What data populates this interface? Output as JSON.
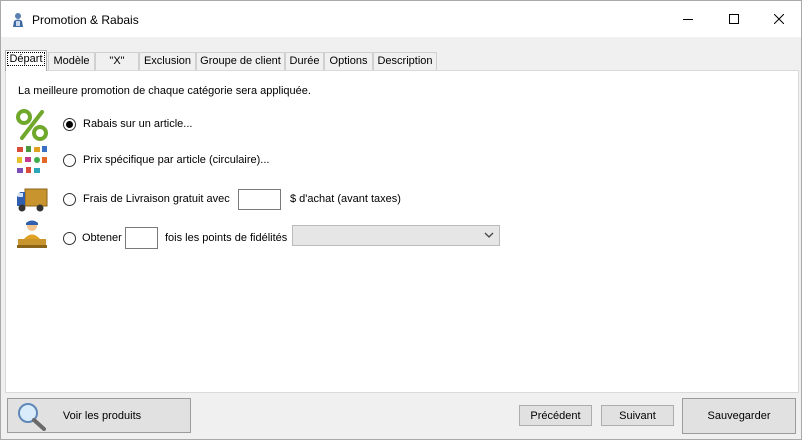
{
  "window": {
    "title": "Promotion & Rabais"
  },
  "tabs": [
    {
      "label": "Départ",
      "active": true
    },
    {
      "label": "Modèle"
    },
    {
      "label": "\"X\""
    },
    {
      "label": "Exclusion"
    },
    {
      "label": "Groupe de client"
    },
    {
      "label": "Durée"
    },
    {
      "label": "Options"
    },
    {
      "label": "Description"
    }
  ],
  "panel": {
    "intro": "La meilleure promotion de chaque catégorie sera appliquée.",
    "options": {
      "rabais": {
        "label": "Rabais sur un article...",
        "selected": true,
        "icon": "percent-icon"
      },
      "prix": {
        "label": "Prix spécifique par article (circulaire)...",
        "selected": false,
        "icon": "products-grid-icon"
      },
      "livraison": {
        "label": "Frais de Livraison gratuit avec",
        "suffix": "$ d'achat (avant taxes)",
        "value": "",
        "selected": false,
        "icon": "delivery-truck-icon"
      },
      "points": {
        "label": "Obtener",
        "suffix": "fois les points de fidélités",
        "value": "",
        "selected": false,
        "icon": "loyalty-person-icon"
      }
    },
    "points_combo": {
      "value": ""
    }
  },
  "buttons": {
    "voir_produits": "Voir les produits",
    "precedent": "Précédent",
    "suivant": "Suivant",
    "sauvegarder": "Sauvegarder"
  }
}
